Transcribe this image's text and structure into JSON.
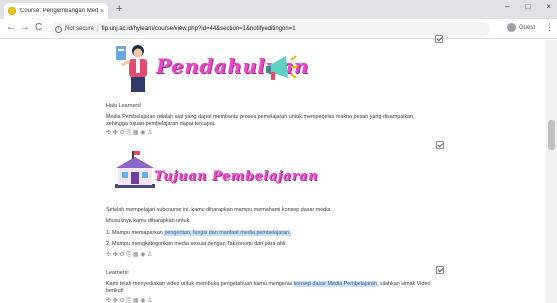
{
  "browser": {
    "tab_title": "Course: Pengembangan Media",
    "tab_close": "×",
    "new_tab": "+",
    "win_minimize": "–",
    "win_maximize": "□",
    "win_close": "×",
    "back": "←",
    "forward": "→",
    "reload": "C",
    "info": "i",
    "security_label": "Not secure",
    "url": "fip.unj.ac.id/hylearn/course/view.php?id=44&section=1&notifyeditingon=1",
    "profile_label": "Guest",
    "menu": "⋮"
  },
  "sections": [
    {
      "title": "Pendahuluan",
      "lines": [
        "Halo Learners!",
        "Media Pembelajaran adalah alat yang dapat membantu proses pemelajaran untuk memperjelas makna pesan yang disampaikan,",
        "sehingga tujuan pembelajaran dapat tercapai."
      ]
    },
    {
      "title": "Tujuan Pembelajaran",
      "intro": "Setelah mempelajari subcourse ini, kamu diharapkan mampu memahami konsep dasar media.",
      "subintro": "khususnya kamu diharapkan untuk:",
      "item1_prefix": "1. Mampu memaparkan",
      "item1_highlight": "pengertian, fungsi dan manfaat media pembelajaran.",
      "item2": "2. Mampu mengkategorikan media sesuai dengan Taksonomi dari para ahli."
    },
    {
      "greeting": "Learners!",
      "line_prefix": "Kami telah menyediakan video untuk membuka pengetahuan kamu mengenai",
      "line_highlight": "konsep dasar Media Pembelajaran",
      "line_suffix": ", silahkan simak Video",
      "line2": "berikut!"
    }
  ],
  "edit_icons": "✣ ✤ ⚙ ⎘ ▦ ◉ ♙"
}
